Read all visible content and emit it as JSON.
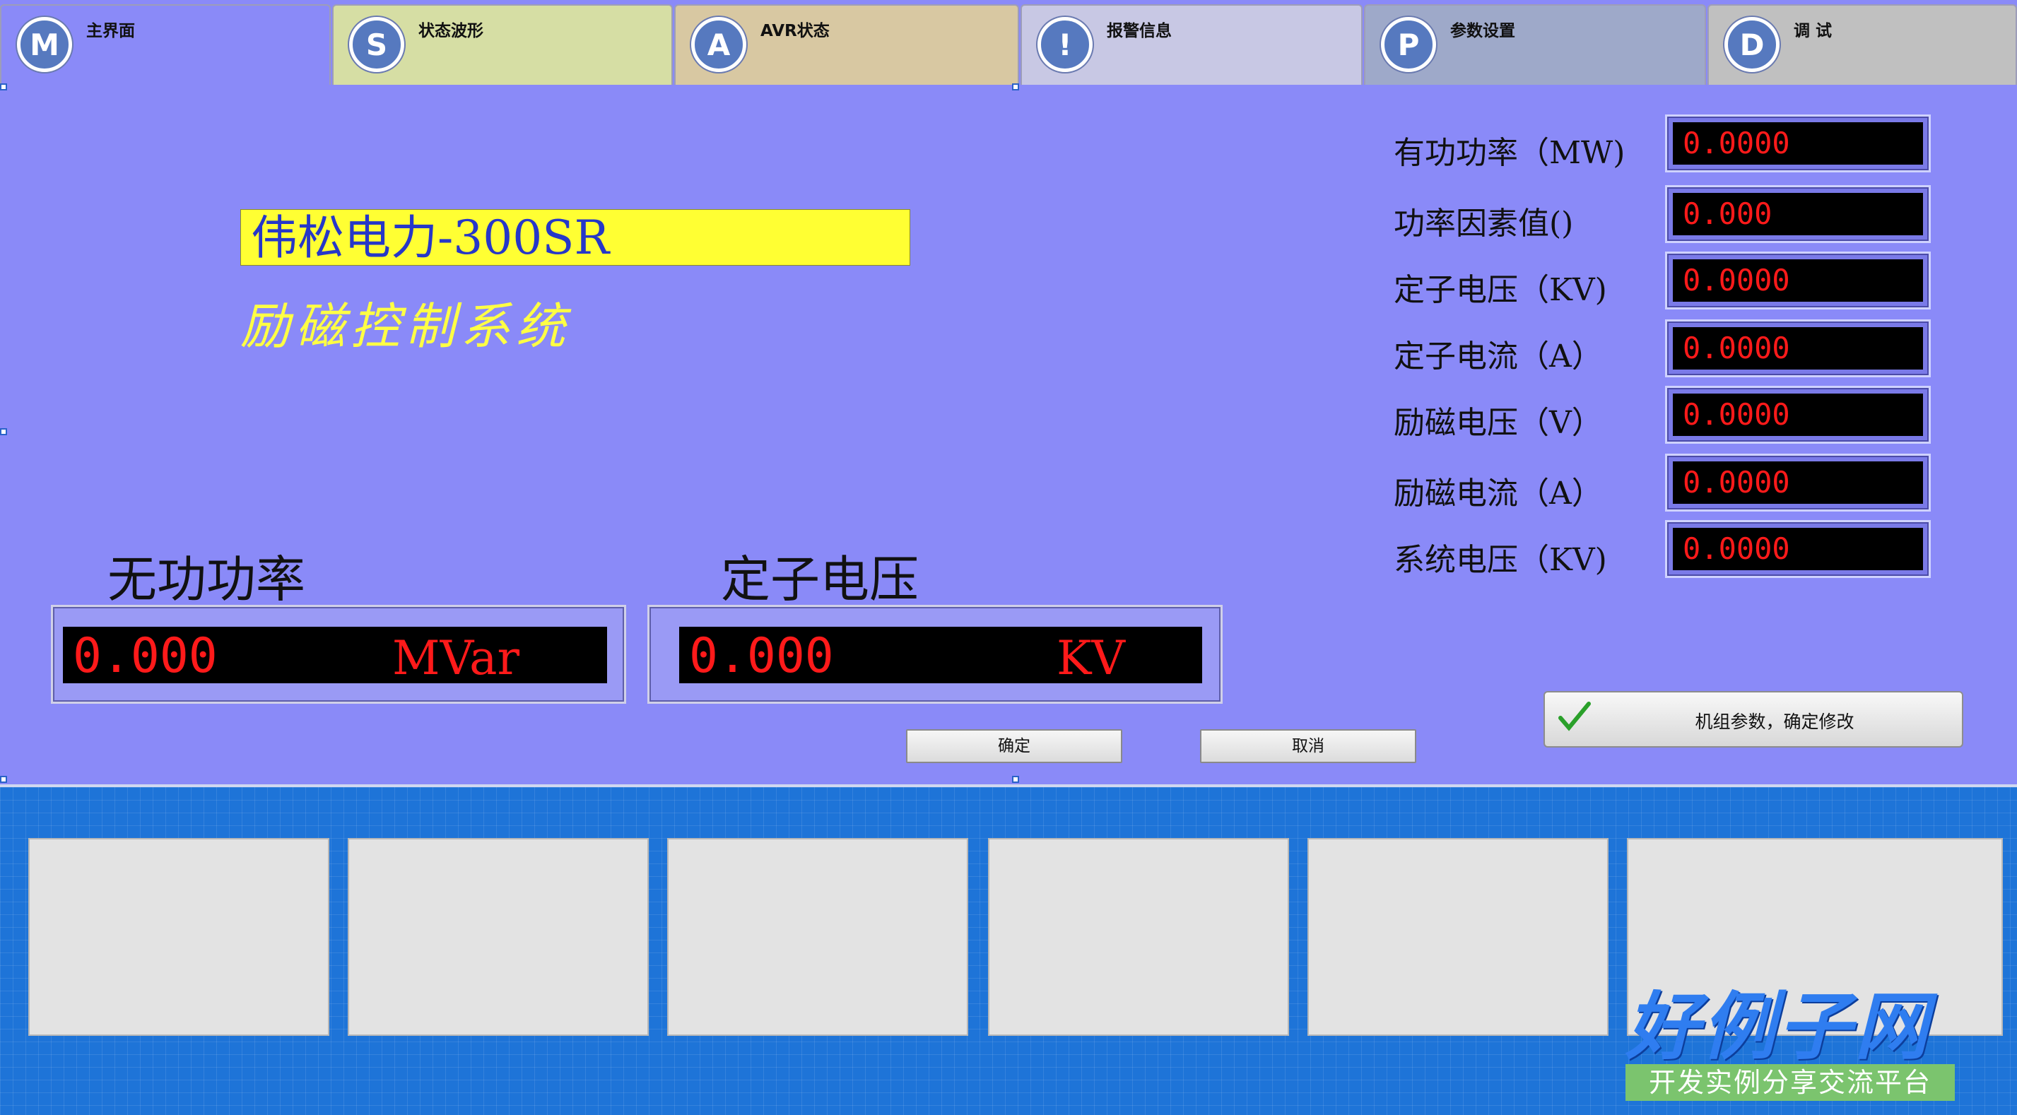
{
  "tabs": [
    {
      "icon_letter": "M",
      "label": "主界面",
      "color": "#8a8af8"
    },
    {
      "icon_letter": "S",
      "label": "状态波形",
      "color": "#d6dea4"
    },
    {
      "icon_letter": "A",
      "label": "AVR状态",
      "color": "#d8c8a2"
    },
    {
      "icon_letter": "!",
      "label": "报警信息",
      "color": "#c8c8e4"
    },
    {
      "icon_letter": "P",
      "label": "参数设置",
      "color": "#9ea9c9"
    },
    {
      "icon_letter": "D",
      "label": "调  试",
      "color": "#c0c0c0"
    }
  ],
  "brand": {
    "title": "伟松电力-300SR",
    "subtitle": "励磁控制系统"
  },
  "params": [
    {
      "label": "有功功率（MW)",
      "value": "0.0000"
    },
    {
      "label": "功率因素值()",
      "value": "0.000"
    },
    {
      "label": "定子电压（KV)",
      "value": "0.0000"
    },
    {
      "label": "定子电流（A）",
      "value": "0.0000"
    },
    {
      "label": "励磁电压（V）",
      "value": "0.0000"
    },
    {
      "label": "励磁电流（A）",
      "value": "0.0000"
    },
    {
      "label": "系统电压（KV)",
      "value": "0.0000"
    }
  ],
  "reactive_power": {
    "title": "无功功率",
    "value": "0.000",
    "unit": "MVar"
  },
  "stator_voltage": {
    "title": "定子电压",
    "value": "0.000",
    "unit": "KV"
  },
  "buttons": {
    "ok": "确定",
    "cancel": "取消",
    "confirm_params": "机组参数，确定修改"
  },
  "watermark": {
    "logo": "好例子网",
    "tagline": "开发实例分享交流平台"
  },
  "colors": {
    "panel_bg": "#8a8af8",
    "readout_text": "#ff1a1a",
    "brand_box": "#ffff33",
    "brand_text": "#2637c8",
    "bottom_bg": "#1e74d8"
  }
}
